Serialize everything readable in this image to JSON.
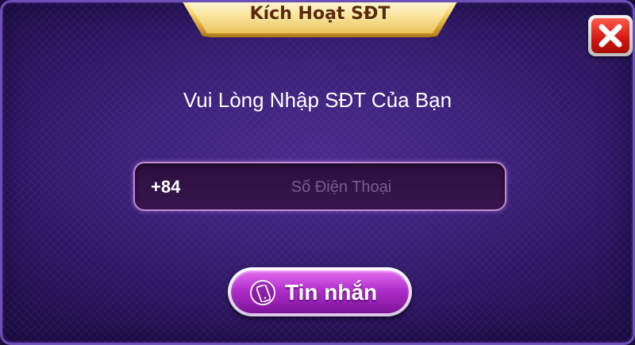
{
  "dialog": {
    "title": "Kích Hoạt SĐT",
    "close_icon": "close-icon"
  },
  "prompt": "Vui Lòng Nhập SĐT Của Bạn",
  "phone": {
    "country_code": "+84",
    "placeholder": "Số Điện Thoại",
    "value": ""
  },
  "sms_button": {
    "label": "Tin nhắn",
    "icon": "mobile-phone-icon"
  },
  "colors": {
    "panel": "#3a2078",
    "title_gold": "#f7d56a",
    "button_purple": "#b02ecb",
    "close_red": "#d3150f"
  }
}
